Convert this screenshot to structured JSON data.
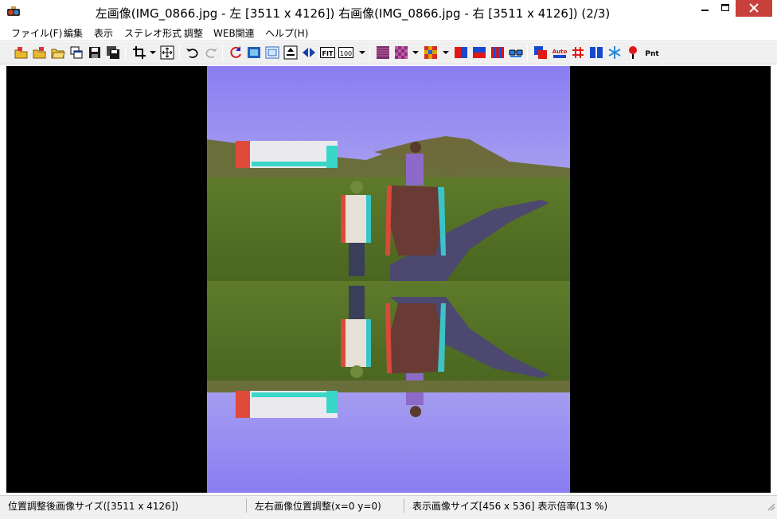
{
  "window": {
    "title": "左画像(IMG_0866.jpg - 左 [3511 x 4126]) 右画像(IMG_0866.jpg - 右 [3511 x 4126])  (2/3)"
  },
  "menu": {
    "items": [
      "ファイル(F)",
      "編集",
      "表示",
      "ステレオ形式",
      "調整",
      "WEB関連",
      "ヘルプ(H)"
    ]
  },
  "toolbar": {
    "fit_label": "FIT",
    "zoom100_label": "100",
    "auto_label": "Auto",
    "pnt_label": "Pnt",
    "icons": [
      "open-left-icon",
      "open-right-icon",
      "open-folder-icon",
      "view-window-icon",
      "save-icon",
      "save-all-icon",
      "crop-icon",
      "move-icon",
      "undo-icon",
      "redo-icon",
      "refresh-icon",
      "frame-icon",
      "frame-blank-icon",
      "align-icon",
      "swap-icon",
      "fit-icon",
      "zoom-100-icon",
      "stripe-horizontal-icon",
      "checker-icon",
      "checker-color-icon",
      "anaglyph-red-blue-icon",
      "anaglyph-top-bottom-icon",
      "stripe-vertical-icon",
      "glasses-icon",
      "overlay-icon",
      "auto-adjust-icon",
      "grid-icon",
      "side-by-side-icon",
      "snowflake-icon",
      "pin-icon",
      "point-icon"
    ]
  },
  "status": {
    "pane1": "位置調整後画像サイズ([3511 x 4126])",
    "pane2": "左右画像位置調整(x=0 y=0)",
    "pane3": "表示画像サイズ[456 x 536]  表示倍率(13 %)"
  },
  "colors": {
    "close_button": "#c7403a",
    "canvas_background": "#000000",
    "sky": "#8e82f2"
  }
}
